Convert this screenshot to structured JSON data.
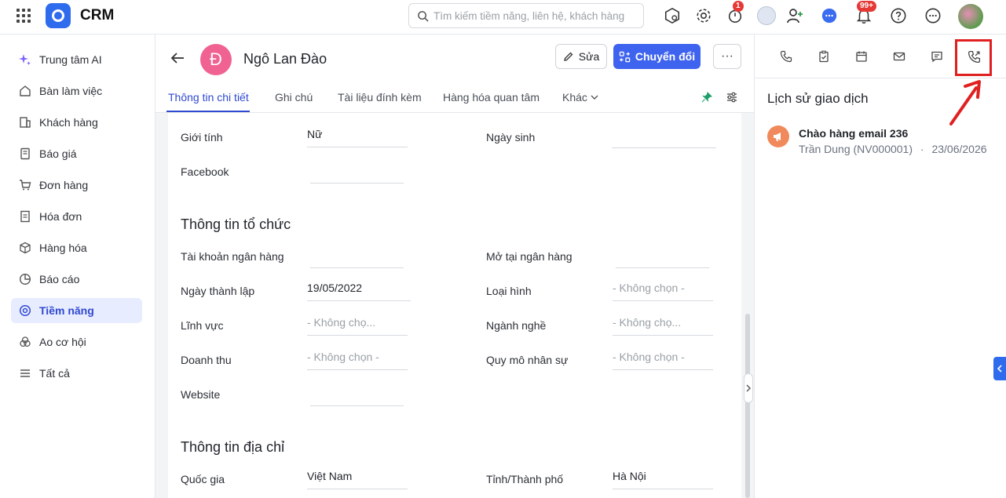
{
  "topbar": {
    "app_title": "CRM",
    "search_placeholder": "Tìm kiếm tiềm năng, liên hệ, khách hàng",
    "timer_badge": "1",
    "notify_badge": "99+"
  },
  "sidebar": {
    "items": [
      {
        "label": "Trung tâm AI",
        "icon": "sparkle-icon"
      },
      {
        "label": "Bàn làm việc",
        "icon": "home-icon"
      },
      {
        "label": "Khách hàng",
        "icon": "building-icon"
      },
      {
        "label": "Báo giá",
        "icon": "quote-icon"
      },
      {
        "label": "Đơn hàng",
        "icon": "cart-icon"
      },
      {
        "label": "Hóa đơn",
        "icon": "invoice-icon"
      },
      {
        "label": "Hàng hóa",
        "icon": "box-icon"
      },
      {
        "label": "Báo cáo",
        "icon": "pie-icon"
      },
      {
        "label": "Tiềm năng",
        "icon": "target-icon"
      },
      {
        "label": "Ao cơ hội",
        "icon": "pool-icon"
      },
      {
        "label": "Tất cả",
        "icon": "menu-icon"
      }
    ],
    "active_index": 8
  },
  "record": {
    "avatar_letter": "Đ",
    "name": "Ngô Lan Đào",
    "edit_label": "Sửa",
    "convert_label": "Chuyển đổi",
    "more_label": "···"
  },
  "tabs": [
    {
      "label": "Thông tin chi tiết"
    },
    {
      "label": "Ghi chú"
    },
    {
      "label": "Tài liệu đính kèm"
    },
    {
      "label": "Hàng hóa quan tâm"
    },
    {
      "label": "Khác"
    }
  ],
  "form": {
    "gender_label": "Giới tính",
    "gender_value": "Nữ",
    "birthday_label": "Ngày sinh",
    "birthday_value": "",
    "facebook_label": "Facebook",
    "facebook_value": "",
    "org_section": "Thông tin tổ chức",
    "bank_account_label": "Tài khoản ngân hàng",
    "bank_account_value": "",
    "bank_at_label": "Mở tại ngân hàng",
    "bank_at_value": "",
    "founded_label": "Ngày thành lập",
    "founded_value": "19/05/2022",
    "type_label": "Loại hình",
    "type_value": "- Không chọn -",
    "field_label": "Lĩnh vực",
    "field_value": "- Không chọ...",
    "industry_label": "Ngành nghề",
    "industry_value": "- Không chọ...",
    "revenue_label": "Doanh thu",
    "revenue_value": "- Không chọn -",
    "staff_label": "Quy mô nhân sự",
    "staff_value": "- Không chọn -",
    "website_label": "Website",
    "website_value": "",
    "address_section": "Thông tin địa chỉ",
    "country_label": "Quốc gia",
    "country_value": "Việt Nam",
    "province_label": "Tỉnh/Thành phố",
    "province_value": "Hà Nội"
  },
  "right_panel": {
    "title": "Lịch sử giao dịch",
    "history": [
      {
        "title": "Chào hàng email 236",
        "owner": "Trần Dung (NV000001)",
        "separator": "·",
        "date": "23/06/2026"
      }
    ]
  },
  "colors": {
    "accent": "#3e63ee",
    "avatar": "#f06292",
    "highlight": "#e02020",
    "history_icon": "#f08a5d"
  }
}
